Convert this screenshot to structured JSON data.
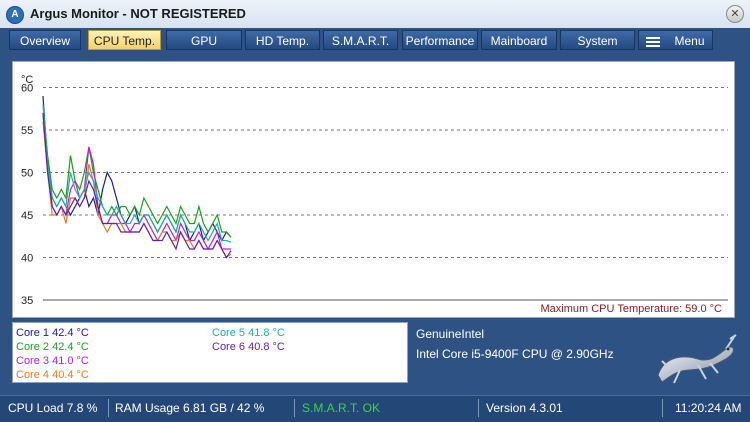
{
  "window": {
    "title": "Argus Monitor - NOT REGISTERED"
  },
  "tabs": [
    {
      "label": "Overview",
      "active": false
    },
    {
      "label": "CPU Temp.",
      "active": true
    },
    {
      "label": "GPU",
      "active": false
    },
    {
      "label": "HD Temp.",
      "active": false
    },
    {
      "label": "S.M.A.R.T.",
      "active": false
    },
    {
      "label": "Performance",
      "active": false
    },
    {
      "label": "Mainboard",
      "active": false
    },
    {
      "label": "System",
      "active": false
    },
    {
      "label": "Menu",
      "active": false
    }
  ],
  "chart_data": {
    "type": "line",
    "ylabel": "°C",
    "ylim": [
      35,
      63
    ],
    "y_ticks": [
      60,
      55,
      50,
      45,
      40,
      35
    ],
    "grid": "dashed horizontal",
    "annotation": "Maximum CPU Temperature: 59.0 °C",
    "series": [
      {
        "name": "Core 1",
        "color": "#1a1aa8",
        "values": [
          59,
          51,
          47,
          46,
          47,
          46,
          45,
          46,
          47,
          48,
          46,
          47,
          45,
          48,
          50,
          49,
          47,
          45,
          44,
          45,
          46,
          44,
          45,
          45,
          44,
          43,
          44,
          45,
          44,
          43,
          45,
          44,
          42,
          43,
          44,
          42,
          43,
          44,
          43,
          42,
          43,
          42.4
        ]
      },
      {
        "name": "Core 2",
        "color": "#17a317",
        "values": [
          58,
          52,
          48,
          47,
          48,
          47,
          52,
          49,
          48,
          50,
          53,
          50,
          48,
          46,
          45,
          46,
          45,
          46,
          46,
          45,
          46,
          45,
          47,
          46,
          45,
          44,
          45,
          46,
          45,
          44,
          46,
          45,
          44,
          44,
          46,
          44,
          43,
          44,
          45,
          43,
          43,
          42.4
        ]
      },
      {
        "name": "Core 3",
        "color": "#c21bd4",
        "values": [
          57,
          51,
          46,
          45,
          46,
          45,
          48,
          49,
          47,
          48,
          53,
          51,
          46,
          44,
          44,
          45,
          45,
          44,
          44,
          43,
          44,
          44,
          45,
          44,
          43,
          42,
          43,
          44,
          43,
          42,
          44,
          43,
          42,
          42,
          43,
          42,
          41,
          42,
          43,
          41,
          41,
          41.0
        ]
      },
      {
        "name": "Core 4",
        "color": "#f07a18",
        "values": [
          56,
          50,
          45,
          45,
          46,
          44,
          47,
          47,
          46,
          47,
          51,
          49,
          45,
          44,
          43,
          44,
          44,
          44,
          43,
          43,
          43,
          43,
          44,
          43,
          42,
          42,
          43,
          43,
          42,
          42,
          43,
          42,
          42,
          41,
          42,
          41,
          41,
          41,
          42,
          41,
          40,
          40.4
        ]
      },
      {
        "name": "Core 5",
        "color": "#1ab2a6",
        "values": [
          58,
          51,
          47,
          46,
          47,
          46,
          50,
          48,
          47,
          48,
          50,
          49,
          47,
          46,
          45,
          45,
          46,
          45,
          44,
          44,
          45,
          44,
          45,
          45,
          44,
          43,
          44,
          45,
          44,
          43,
          45,
          44,
          43,
          43,
          44,
          43,
          42,
          43,
          44,
          42,
          42,
          41.8
        ]
      },
      {
        "name": "Core 6",
        "color": "#5a20c8",
        "values": [
          57,
          50,
          46,
          45,
          46,
          45,
          46,
          47,
          46,
          47,
          49,
          48,
          46,
          44,
          44,
          44,
          44,
          43,
          43,
          43,
          43,
          43,
          44,
          43,
          42,
          42,
          42,
          43,
          42,
          41,
          43,
          42,
          41,
          41,
          42,
          41,
          41,
          41,
          42,
          41,
          40,
          40.8
        ]
      }
    ]
  },
  "max_temp_label": "Maximum CPU Temperature: 59.0 °C",
  "cores": [
    {
      "label": "Core 1 42.4 °C",
      "color": "#1a1aa8"
    },
    {
      "label": "Core 2 42.4 °C",
      "color": "#17a317"
    },
    {
      "label": "Core 3 41.0 °C",
      "color": "#c21bd4"
    },
    {
      "label": "Core 4 40.4 °C",
      "color": "#f07a18"
    },
    {
      "label": "Core 5 41.8 °C",
      "color": "#1ab2a6"
    },
    {
      "label": "Core 6 40.8 °C",
      "color": "#5a20c8"
    }
  ],
  "cpu": {
    "vendor": "GenuineIntel",
    "model": "Intel Core i5-9400F CPU @ 2.90GHz"
  },
  "status": {
    "cpu_load": "CPU Load 7.8 %",
    "ram_usage": "RAM Usage 6.81 GB / 42 %",
    "smart": "S.M.A.R.T. OK",
    "version": "Version 4.3.01",
    "time": "11:20:24 AM"
  },
  "colors": {
    "accent": "#2e5283",
    "active_tab": "#f3d26b",
    "smart_ok": "#3dd43d",
    "max_temp": "#8a1b1b"
  },
  "icons": {
    "app": "argus-logo-icon",
    "close": "close-icon",
    "menu": "hamburger-menu-icon",
    "logo": "salamander-logo"
  }
}
